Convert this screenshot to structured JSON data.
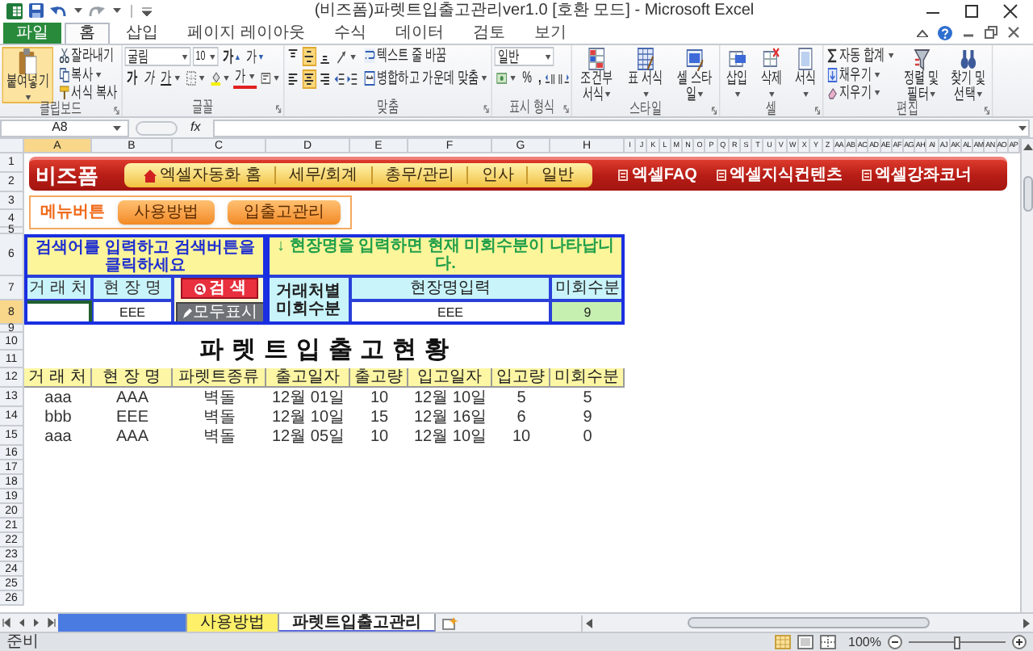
{
  "title_bar": {
    "title": "(비즈폼)파렛트입출고관리ver1.0  [호환 모드] - Microsoft Excel"
  },
  "ribbon_tabs": [
    {
      "label": "파일",
      "kind": "file",
      "selected": false
    },
    {
      "label": "홈",
      "kind": "tab",
      "selected": true
    },
    {
      "label": "삽입",
      "kind": "tab",
      "selected": false
    },
    {
      "label": "페이지 레이아웃",
      "kind": "tab",
      "selected": false
    },
    {
      "label": "수식",
      "kind": "tab",
      "selected": false
    },
    {
      "label": "데이터",
      "kind": "tab",
      "selected": false
    },
    {
      "label": "검토",
      "kind": "tab",
      "selected": false
    },
    {
      "label": "보기",
      "kind": "tab",
      "selected": false
    }
  ],
  "clipboard": {
    "label": "클립보드",
    "paste": "붙여넣기",
    "cut": "잘라내기",
    "copy": "복사",
    "format_painter": "서식 복사"
  },
  "font": {
    "label": "글꼴",
    "name": "굴림",
    "size": "10",
    "grow": "가",
    "shrink": "가",
    "bold": "가",
    "italic": "가",
    "underline": "가",
    "font_color": "가"
  },
  "alignment": {
    "label": "맞춤",
    "vertical_buttons": [
      {
        "kind": "top",
        "selected": false
      },
      {
        "kind": "middle",
        "selected": true
      },
      {
        "kind": "bottom",
        "selected": false
      }
    ],
    "horizontal_buttons": [
      {
        "kind": "left",
        "selected": false
      },
      {
        "kind": "center",
        "selected": true
      },
      {
        "kind": "right",
        "selected": false
      }
    ],
    "wrap_text": "텍스트 줄 바꿈",
    "merge": "병합하고 가운데 맞춤"
  },
  "number": {
    "label": "표시 형식",
    "format": "일반",
    "percent": "%",
    "comma": ","
  },
  "styles": {
    "label": "스타일",
    "buttons": [
      {
        "kind": "conditional",
        "label": "조건부 서식"
      },
      {
        "kind": "table",
        "label": "표 서식"
      },
      {
        "kind": "cell",
        "label": "셀 스타일"
      }
    ]
  },
  "cells": {
    "label": "셀",
    "buttons": [
      {
        "kind": "insert",
        "label": "삽입"
      },
      {
        "kind": "delete",
        "label": "삭제"
      },
      {
        "kind": "format",
        "label": "서식"
      }
    ]
  },
  "editing": {
    "label": "편집",
    "small": [
      {
        "kind": "sum",
        "label": "자동 합계"
      },
      {
        "kind": "fill",
        "label": "채우기"
      },
      {
        "kind": "clear",
        "label": "지우기"
      }
    ],
    "big": [
      {
        "kind": "sort",
        "label": "정렬 및 필터"
      },
      {
        "kind": "find",
        "label": "찾기 및 선택"
      }
    ]
  },
  "formula_bar": {
    "name_box": "A8",
    "fx": "fx"
  },
  "columns": [
    "A",
    "B",
    "C",
    "D",
    "E",
    "F",
    "G",
    "H",
    "I",
    "J",
    "K",
    "L",
    "M",
    "N",
    "O",
    "P",
    "Q",
    "R",
    "S",
    "T",
    "U",
    "V",
    "W",
    "X",
    "Y",
    "Z",
    "AA",
    "AB",
    "AC",
    "AD",
    "AE",
    "AF",
    "AG",
    "AH",
    "AI",
    "AJ",
    "AK",
    "AL",
    "AM",
    "AN",
    "AO",
    "AP"
  ],
  "rows": [
    "1",
    "2",
    "3",
    "4",
    "5",
    "6",
    "7",
    "8",
    "9",
    "10",
    "11",
    "12",
    "13",
    "14",
    "15",
    "16",
    "17",
    "18",
    "19",
    "20",
    "21",
    "22",
    "23",
    "24",
    "25",
    "26"
  ],
  "banner": {
    "logo": "비즈폼",
    "nav": [
      {
        "label": "엑셀자동화 홈",
        "kind": "home"
      },
      {
        "label": "세무/회계",
        "kind": "plain"
      },
      {
        "label": "총무/관리",
        "kind": "plain"
      },
      {
        "label": "인사",
        "kind": "plain"
      },
      {
        "label": "일반",
        "kind": "plain"
      }
    ],
    "links": [
      "엑셀FAQ",
      "엑셀지식컨텐츠",
      "엑셀강좌코너"
    ]
  },
  "menu_box": {
    "label": "메뉴버튼",
    "buttons": [
      "사용방법",
      "입출고관리"
    ]
  },
  "search": {
    "instruction": "검색어를 입력하고 검색버튼을 클릭하세요",
    "headers": [
      "거 래 처",
      "현 장 명"
    ],
    "inputs": [
      {
        "selected": true
      },
      {
        "value": "EEE",
        "selected": false
      }
    ],
    "search_button": "검 색",
    "show_all_button": "모두표시"
  },
  "lookup": {
    "note": "↓ 현장명을 입력하면 현재 미회수분이 나타납니다.",
    "side_label": "거래처별 미회수분",
    "headers": [
      "현장명입력",
      "미회수분"
    ],
    "site": "EEE",
    "unreturned": "9"
  },
  "report": {
    "title": "파 렛 트 입 출 고 현 황",
    "columns": [
      "거 래 처",
      "현 장 명",
      "파렛트종류",
      "출고일자",
      "출고량",
      "입고일자",
      "입고량",
      "미회수분"
    ],
    "rows": [
      [
        "aaa",
        "AAA",
        "벽돌",
        "12월 01일",
        "10",
        "12월 10일",
        "5",
        "5"
      ],
      [
        "bbb",
        "EEE",
        "벽돌",
        "12월 10일",
        "15",
        "12월 16일",
        "6",
        "9"
      ],
      [
        "aaa",
        "AAA",
        "벽돌",
        "12월 05일",
        "10",
        "12월 10일",
        "10",
        "0"
      ]
    ]
  },
  "sheet_tabs": [
    {
      "color": "#4a7be0",
      "selected": false
    },
    {
      "label": "사용방법",
      "color": "#fff06a",
      "selected": false
    },
    {
      "label": "파렛트입출고관리",
      "selected": true
    }
  ],
  "status_bar": {
    "text": "준비",
    "zoom": "100%",
    "level": 0.5
  }
}
